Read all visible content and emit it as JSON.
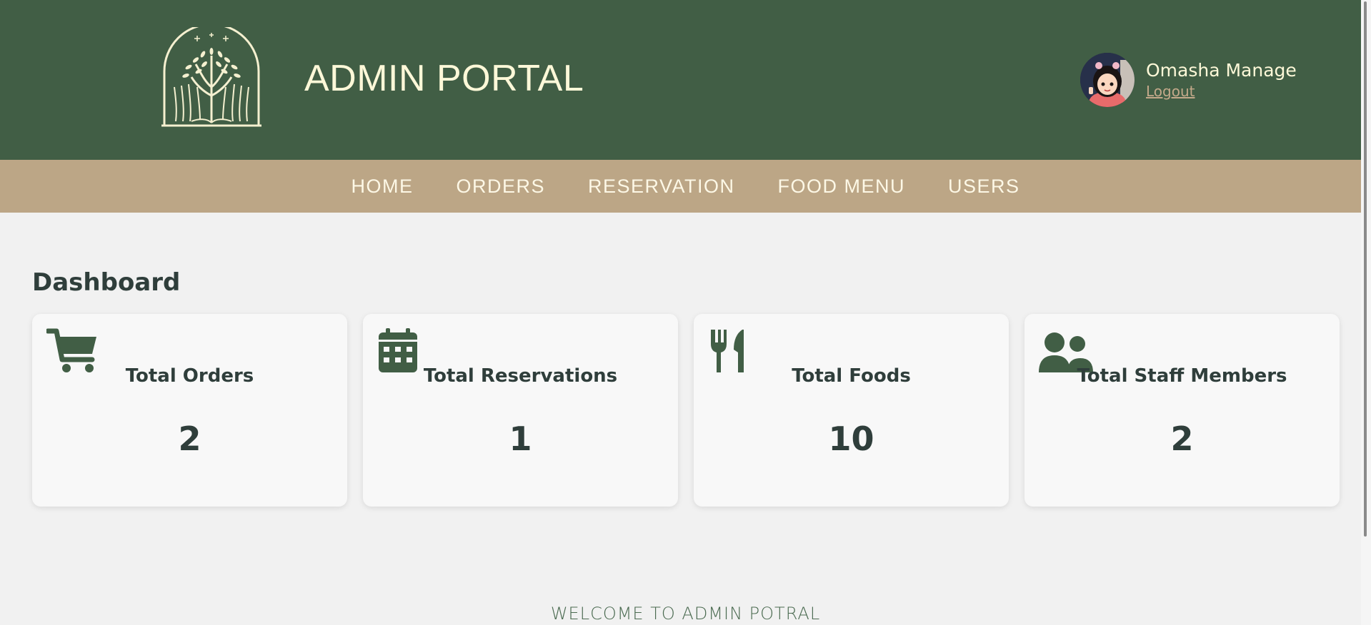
{
  "header": {
    "title": "ADMIN PORTAL",
    "logo_icon": "tree-logo-icon",
    "user": {
      "name": "Omasha Manage",
      "logout_label": "Logout",
      "avatar_icon": "avatar-icon"
    }
  },
  "nav": {
    "items": [
      {
        "label": "HOME"
      },
      {
        "label": "ORDERS"
      },
      {
        "label": "RESERVATION"
      },
      {
        "label": "FOOD MENU"
      },
      {
        "label": "USERS"
      }
    ]
  },
  "main": {
    "title": "Dashboard",
    "cards": [
      {
        "icon": "cart-icon",
        "label": "Total Orders",
        "value": "2"
      },
      {
        "icon": "calendar-icon",
        "label": "Total Reservations",
        "value": "1"
      },
      {
        "icon": "utensils-icon",
        "label": "Total Foods",
        "value": "10"
      },
      {
        "icon": "users-icon",
        "label": "Total Staff Members",
        "value": "2"
      }
    ]
  },
  "footer": {
    "welcome_text": "WELCOME TO ADMIN POTRAL"
  },
  "colors": {
    "header_bg": "#415e45",
    "nav_bg": "#bca686",
    "page_bg": "#f1f1f1",
    "card_bg": "#f8f8f8",
    "icon_color": "#415e45",
    "text_dark": "#2f3e3b",
    "title_text": "#fdf8d8"
  }
}
